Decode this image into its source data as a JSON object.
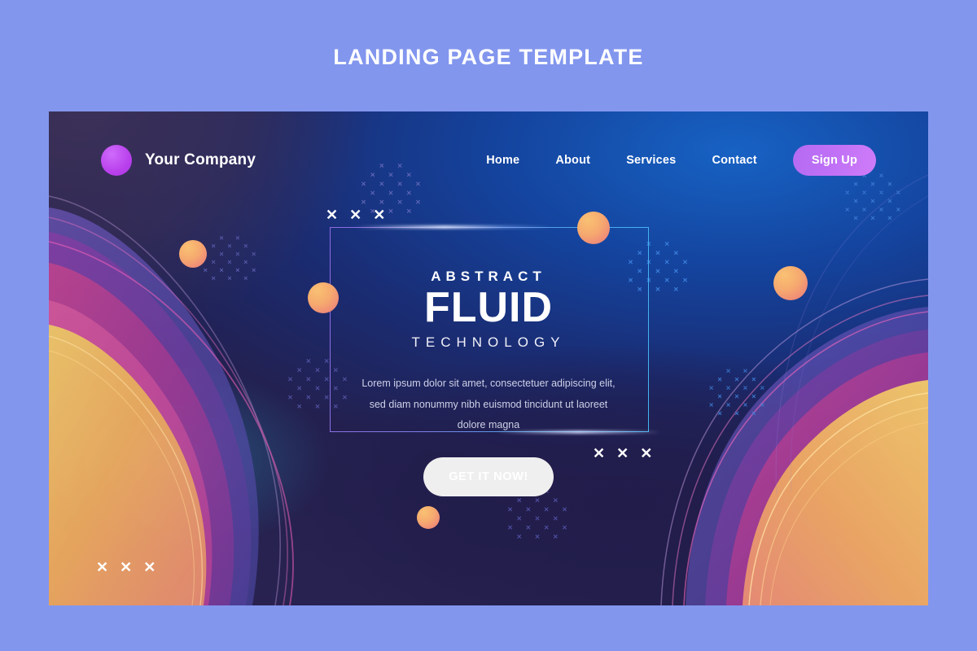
{
  "page": {
    "title": "LANDING PAGE TEMPLATE",
    "background_color": "#8296ee"
  },
  "header": {
    "brand_name": "Your Company",
    "logo_icon": "circle-logo-icon",
    "logo_color": "#bb44ee",
    "nav_items": [
      {
        "label": "Home"
      },
      {
        "label": "About"
      },
      {
        "label": "Services"
      },
      {
        "label": "Contact"
      }
    ],
    "signup_label": "Sign Up",
    "signup_color": "#bb6ef5"
  },
  "hero": {
    "eyebrow": "ABSTRACT",
    "headline": "FLUID",
    "subhead": "TECHNOLOGY",
    "body_text": "Lorem ipsum dolor sit amet, consectetuer adipiscing elit, sed diam nonummy nibh euismod tincidunt ut laoreet dolore magna",
    "cta_label": "GET IT NOW!",
    "cta_color": "#f39a6c"
  },
  "decor": {
    "x_mark": "✕",
    "x_triples": [
      {
        "name": "x-triple-top-left"
      },
      {
        "name": "x-triple-bottom-right"
      },
      {
        "name": "x-triple-bottom-left"
      }
    ],
    "spheres": [
      {
        "name": "sphere-top-center",
        "color": "#f4a36f"
      },
      {
        "name": "sphere-left-upper",
        "color": "#f4a36f"
      },
      {
        "name": "sphere-left-mid",
        "color": "#f4a36f"
      },
      {
        "name": "sphere-right",
        "color": "#f4a36f"
      },
      {
        "name": "sphere-bottom-center",
        "color": "#f4a36f"
      }
    ],
    "dot_clusters": [
      {
        "name": "dot-cluster-top-center",
        "color": "#6a6ab4"
      },
      {
        "name": "dot-cluster-left",
        "color": "#6a6ab4"
      },
      {
        "name": "dot-cluster-left-lower",
        "color": "#5a5aa8"
      },
      {
        "name": "dot-cluster-center-right",
        "color": "#3f7fd8"
      },
      {
        "name": "dot-cluster-right-upper",
        "color": "#3f7fd8"
      },
      {
        "name": "dot-cluster-right-lower",
        "color": "#3f7fd8"
      },
      {
        "name": "dot-cluster-bottom-center",
        "color": "#5a5ab0"
      }
    ],
    "wave_colors": {
      "orange": "#f5b45f",
      "peach": "#f0926f",
      "magenta": "#c23a94",
      "purple": "#7a3a9c",
      "violet": "#5b46a8"
    }
  }
}
